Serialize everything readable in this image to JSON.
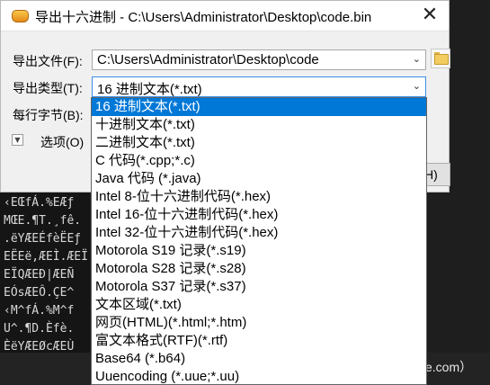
{
  "background": {
    "hex_lines": [
      "‹EŒfÁ.%EÆƒ",
      "MŒE.¶T.¸fê.",
      ".ëYÆEÉfèËEƒ",
      "EËEë,ÆEÌ.ÆEÏ",
      "EÏQÆEÐ|ÆEÑ",
      "EÓsÆEÔ.ÇE^",
      "‹M^fÁ.%M^f",
      "U^.¶D.Èfè.",
      "ÈëYÆEØcÆEÙ"
    ],
    "bottom_text": "ke.com）"
  },
  "dialog": {
    "title": "导出十六进制 - C:\\Users\\Administrator\\Desktop\\code.bin",
    "close_glyph": "✕",
    "file_label": "导出文件(F):",
    "file_value": "C:\\Users\\Administrator\\Desktop\\code",
    "type_label": "导出类型(T):",
    "type_value": "16 进制文本(*.txt)",
    "bytes_label": "每行字节(B):",
    "options_label": "选项(O)",
    "ok_peek": "H)"
  },
  "dropdown": {
    "selected_index": 0,
    "options": [
      "16 进制文本(*.txt)",
      "十进制文本(*.txt)",
      "二进制文本(*.txt)",
      "C 代码(*.cpp;*.c)",
      "Java 代码 (*.java)",
      "Intel 8-位十六进制代码(*.hex)",
      "Intel 16-位十六进制代码(*.hex)",
      "Intel 32-位十六进制代码(*.hex)",
      "Motorola S19 记录(*.s19)",
      "Motorola S28 记录(*.s28)",
      "Motorola S37 记录(*.s37)",
      "文本区域(*.txt)",
      "网页(HTML)(*.html;*.htm)",
      "富文本格式(RTF)(*.rtf)",
      "Base64 (*.b64)",
      "Uuencoding (*.uue;*.uu)"
    ]
  },
  "colors": {
    "selected_bg": "#0078d7",
    "accent_border": "#3a8ee8"
  }
}
